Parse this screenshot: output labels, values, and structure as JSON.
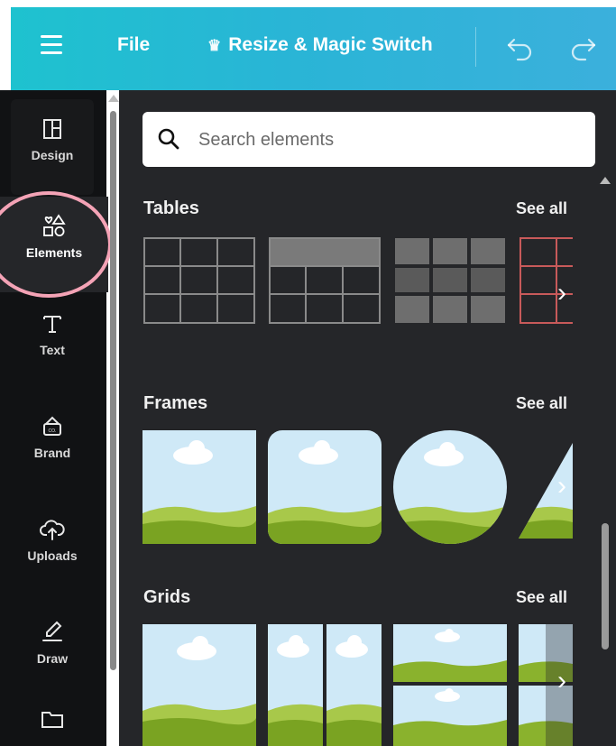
{
  "topbar": {
    "file_label": "File",
    "resize_label": "Resize & Magic Switch",
    "menu_icon": "hamburger-menu-icon",
    "crown_icon": "crown-icon",
    "undo_icon": "undo-icon",
    "redo_icon": "redo-icon",
    "gradient_colors": [
      "#1ec2cf",
      "#3bb0dc"
    ]
  },
  "sidebar": {
    "items": [
      {
        "label": "Design",
        "icon": "layout-icon"
      },
      {
        "label": "Elements",
        "icon": "shapes-icon",
        "active": true
      },
      {
        "label": "Text",
        "icon": "text-t-icon"
      },
      {
        "label": "Brand",
        "icon": "brand-kit-icon"
      },
      {
        "label": "Uploads",
        "icon": "cloud-upload-icon"
      },
      {
        "label": "Draw",
        "icon": "draw-pen-icon"
      },
      {
        "label": "",
        "icon": "folder-icon"
      }
    ],
    "highlight_color": "#f4a3b6"
  },
  "search": {
    "placeholder": "Search elements",
    "value": ""
  },
  "sections": [
    {
      "title": "Tables",
      "see_all": "See all"
    },
    {
      "title": "Frames",
      "see_all": "See all"
    },
    {
      "title": "Grids",
      "see_all": "See all"
    }
  ],
  "colors": {
    "panel_bg": "#252629",
    "sidebar_bg": "#111214",
    "sky": "#cfe9f7",
    "grass": "#8ab22d"
  }
}
